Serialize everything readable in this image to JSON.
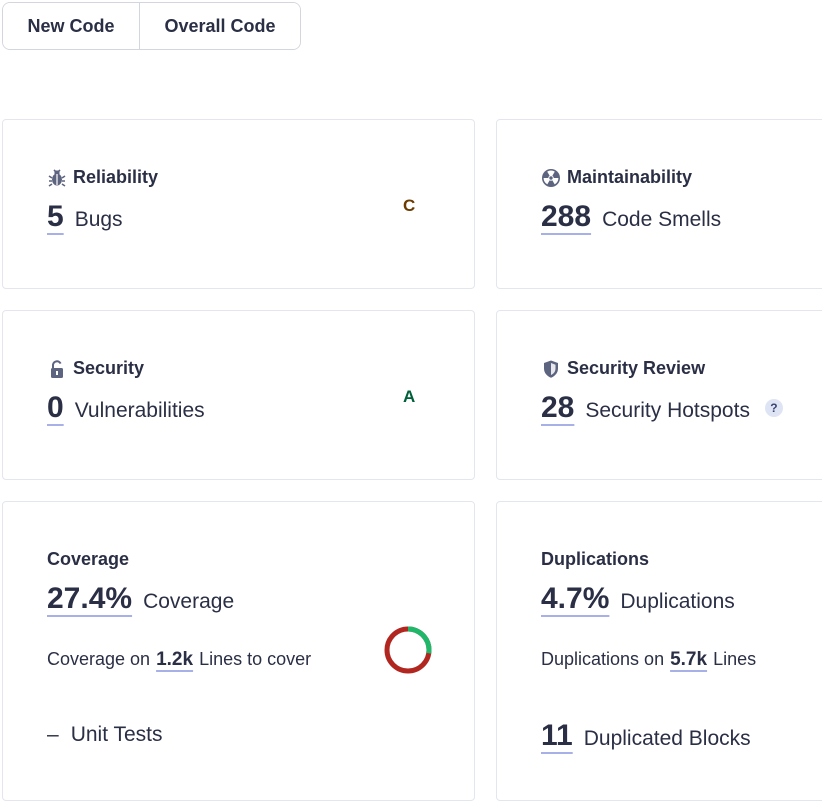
{
  "tabs": {
    "new_code": "New Code",
    "overall_code": "Overall Code"
  },
  "reliability": {
    "title": "Reliability",
    "icon": "bug-icon",
    "value": "5",
    "label": "Bugs",
    "rating": "C"
  },
  "maintainability": {
    "title": "Maintainability",
    "icon": "radiation-icon",
    "value": "288",
    "label": "Code Smells"
  },
  "security": {
    "title": "Security",
    "icon": "lock-icon",
    "value": "0",
    "label": "Vulnerabilities",
    "rating": "A"
  },
  "security_review": {
    "title": "Security Review",
    "icon": "shield-icon",
    "value": "28",
    "label": "Security Hotspots",
    "help": "?"
  },
  "coverage": {
    "title": "Coverage",
    "value": "27.4%",
    "label": "Coverage",
    "sub_prefix": "Coverage on",
    "sub_value": "1.2k",
    "sub_suffix": "Lines to cover",
    "percent": 27.4,
    "unit_tests_dash": "–",
    "unit_tests_label": "Unit Tests"
  },
  "duplications": {
    "title": "Duplications",
    "value": "4.7%",
    "label": "Duplications",
    "sub_prefix": "Duplications on",
    "sub_value": "5.7k",
    "sub_suffix": "Lines",
    "blocks_value": "11",
    "blocks_label": "Duplicated Blocks"
  },
  "colors": {
    "covered": "#1fb86a",
    "uncovered": "#b1271f",
    "underline": "#a7b1e8"
  }
}
